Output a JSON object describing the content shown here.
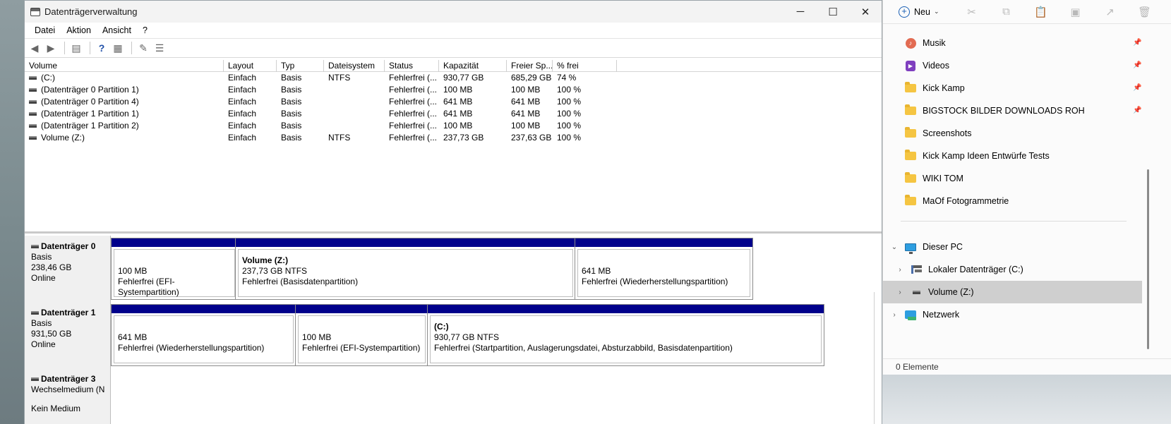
{
  "window": {
    "title": "Datenträgerverwaltung",
    "controls": {
      "minimize": "─",
      "maximize": "☐",
      "close": "✕"
    }
  },
  "menu": [
    "Datei",
    "Aktion",
    "Ansicht",
    "?"
  ],
  "columns": [
    "Volume",
    "Layout",
    "Typ",
    "Dateisystem",
    "Status",
    "Kapazität",
    "Freier Sp...",
    "% frei"
  ],
  "volumes": [
    [
      "(C:)",
      "Einfach",
      "Basis",
      "NTFS",
      "Fehlerfrei (...",
      "930,77 GB",
      "685,29 GB",
      "74 %"
    ],
    [
      "(Datenträger 0 Partition 1)",
      "Einfach",
      "Basis",
      "",
      "Fehlerfrei (...",
      "100 MB",
      "100 MB",
      "100 %"
    ],
    [
      "(Datenträger 0 Partition 4)",
      "Einfach",
      "Basis",
      "",
      "Fehlerfrei (...",
      "641 MB",
      "641 MB",
      "100 %"
    ],
    [
      "(Datenträger 1 Partition 1)",
      "Einfach",
      "Basis",
      "",
      "Fehlerfrei (...",
      "641 MB",
      "641 MB",
      "100 %"
    ],
    [
      "(Datenträger 1 Partition 2)",
      "Einfach",
      "Basis",
      "",
      "Fehlerfrei (...",
      "100 MB",
      "100 MB",
      "100 %"
    ],
    [
      "Volume (Z:)",
      "Einfach",
      "Basis",
      "NTFS",
      "Fehlerfrei (...",
      "237,73 GB",
      "237,63 GB",
      "100 %"
    ]
  ],
  "disks": [
    {
      "name": "Datenträger 0",
      "type": "Basis",
      "size": "238,46 GB",
      "state": "Online",
      "partitions": [
        {
          "name": "",
          "size": "100 MB",
          "status": "Fehlerfrei (EFI-Systempartition)"
        },
        {
          "name": "Volume  (Z:)",
          "size": "237,73 GB NTFS",
          "status": "Fehlerfrei (Basisdatenpartition)"
        },
        {
          "name": "",
          "size": "641 MB",
          "status": "Fehlerfrei (Wiederherstellungspartition)"
        }
      ]
    },
    {
      "name": "Datenträger 1",
      "type": "Basis",
      "size": "931,50 GB",
      "state": "Online",
      "partitions": [
        {
          "name": "",
          "size": "641 MB",
          "status": "Fehlerfrei (Wiederherstellungspartition)"
        },
        {
          "name": "",
          "size": "100 MB",
          "status": "Fehlerfrei (EFI-Systempartition)"
        },
        {
          "name": "(C:)",
          "size": "930,77 GB NTFS",
          "status": "Fehlerfrei (Startpartition, Auslagerungsdatei, Absturzabbild, Basisdatenpartition)"
        }
      ]
    },
    {
      "name": "Datenträger 3",
      "type": "Wechselmedium (N",
      "size": "",
      "state": "Kein Medium",
      "partitions": []
    }
  ],
  "explorer": {
    "new_label": "Neu",
    "quick_access": [
      {
        "label": "Musik",
        "icon": "music-icon",
        "pinned": true
      },
      {
        "label": "Videos",
        "icon": "video-icon",
        "pinned": true
      },
      {
        "label": "Kick Kamp",
        "icon": "folder-icon",
        "pinned": true
      },
      {
        "label": "BIGSTOCK BILDER DOWNLOADS ROH",
        "icon": "folder-icon",
        "pinned": true
      },
      {
        "label": "Screenshots",
        "icon": "folder-icon",
        "pinned": false
      },
      {
        "label": "Kick Kamp Ideen Entwürfe Tests",
        "icon": "folder-icon",
        "pinned": false
      },
      {
        "label": "WIKI TOM",
        "icon": "folder-icon",
        "pinned": false
      },
      {
        "label": "MaOf Fotogrammetrie",
        "icon": "folder-icon",
        "pinned": false
      }
    ],
    "this_pc": "Dieser PC",
    "drives": [
      "Lokaler Datenträger (C:)",
      "Volume (Z:)"
    ],
    "network": "Netzwerk",
    "status": "0 Elemente"
  }
}
